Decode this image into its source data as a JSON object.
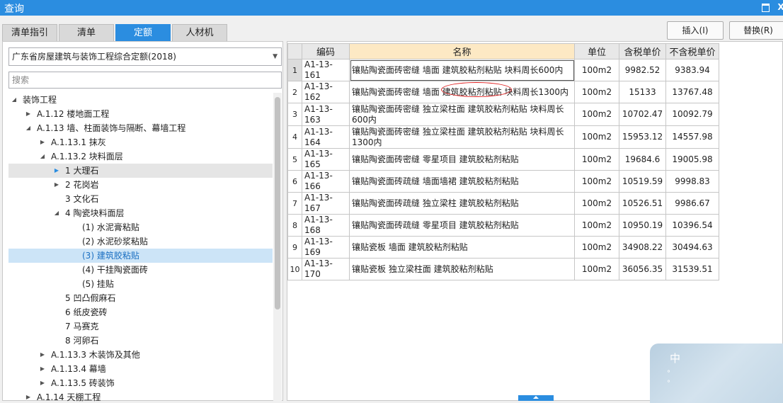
{
  "window": {
    "title": "查询",
    "close_label": "X"
  },
  "tabs": [
    {
      "label": "清单指引"
    },
    {
      "label": "清单"
    },
    {
      "label": "定额"
    },
    {
      "label": "人材机"
    }
  ],
  "actions": {
    "insert_label": "插入(I)",
    "replace_label": "替换(R)"
  },
  "quota_library": {
    "selected": "广东省房屋建筑与装饰工程综合定额(2018)"
  },
  "search": {
    "placeholder": "搜索",
    "value": ""
  },
  "tree": [
    {
      "label": "装饰工程"
    },
    {
      "label": "A.1.12 楼地面工程"
    },
    {
      "label": "A.1.13 墙、柱面装饰与隔断、幕墙工程"
    },
    {
      "label": "A.1.13.1 抹灰"
    },
    {
      "label": "A.1.13.2 块料面层"
    },
    {
      "label": "1 大理石"
    },
    {
      "label": "2 花岗岩"
    },
    {
      "label": "3 文化石"
    },
    {
      "label": "4 陶瓷块料面层"
    },
    {
      "label": "(1) 水泥膏粘贴"
    },
    {
      "label": "(2) 水泥砂浆粘贴"
    },
    {
      "label": "(3) 建筑胶粘贴"
    },
    {
      "label": "(4) 干挂陶瓷面砖"
    },
    {
      "label": "(5) 挂贴"
    },
    {
      "label": "5 凹凸假麻石"
    },
    {
      "label": "6 纸皮瓷砖"
    },
    {
      "label": "7 马赛克"
    },
    {
      "label": "8 河卵石"
    },
    {
      "label": "A.1.13.3 木装饰及其他"
    },
    {
      "label": "A.1.13.4 幕墙"
    },
    {
      "label": "A.1.13.5 砖装饰"
    },
    {
      "label": "A.1.14 天棚工程"
    }
  ],
  "grid": {
    "columns": [
      "编码",
      "名称",
      "单位",
      "含税单价",
      "不含税单价"
    ],
    "rows": [
      {
        "no": "1",
        "code": "A1-13-161",
        "name": "镶贴陶瓷面砖密缝 墙面 建筑胶粘剂粘贴 块料周长600内",
        "unit": "100m2",
        "price_tax": "9982.52",
        "price_notax": "9383.94"
      },
      {
        "no": "2",
        "code": "A1-13-162",
        "name": "镶贴陶瓷面砖密缝 墙面 建筑胶粘剂粘贴 块料周长1300内",
        "unit": "100m2",
        "price_tax": "15133",
        "price_notax": "13767.48"
      },
      {
        "no": "3",
        "code": "A1-13-163",
        "name": "镶贴陶瓷面砖密缝 独立梁柱面 建筑胶粘剂粘贴 块料周长600内",
        "unit": "100m2",
        "price_tax": "10702.47",
        "price_notax": "10092.79"
      },
      {
        "no": "4",
        "code": "A1-13-164",
        "name": "镶贴陶瓷面砖密缝 独立梁柱面 建筑胶粘剂粘贴 块料周长1300内",
        "unit": "100m2",
        "price_tax": "15953.12",
        "price_notax": "14557.98"
      },
      {
        "no": "5",
        "code": "A1-13-165",
        "name": "镶贴陶瓷面砖密缝 零星项目 建筑胶粘剂粘贴",
        "unit": "100m2",
        "price_tax": "19684.6",
        "price_notax": "19005.98"
      },
      {
        "no": "6",
        "code": "A1-13-166",
        "name": "镶贴陶瓷面砖疏缝 墙面墙裙 建筑胶粘剂粘贴",
        "unit": "100m2",
        "price_tax": "10519.59",
        "price_notax": "9998.83"
      },
      {
        "no": "7",
        "code": "A1-13-167",
        "name": "镶贴陶瓷面砖疏缝 独立梁柱 建筑胶粘剂粘贴",
        "unit": "100m2",
        "price_tax": "10526.51",
        "price_notax": "9986.67"
      },
      {
        "no": "8",
        "code": "A1-13-168",
        "name": "镶贴陶瓷面砖疏缝 零星项目 建筑胶粘剂粘贴",
        "unit": "100m2",
        "price_tax": "10950.19",
        "price_notax": "10396.54"
      },
      {
        "no": "9",
        "code": "A1-13-169",
        "name": "镶贴瓷板 墙面 建筑胶粘剂粘贴",
        "unit": "100m2",
        "price_tax": "34908.22",
        "price_notax": "30494.63"
      },
      {
        "no": "10",
        "code": "A1-13-170",
        "name": "镶贴瓷板 独立梁柱面 建筑胶粘剂粘贴",
        "unit": "100m2",
        "price_tax": "36056.35",
        "price_notax": "31539.51"
      }
    ]
  },
  "widget": {
    "label": "中"
  }
}
